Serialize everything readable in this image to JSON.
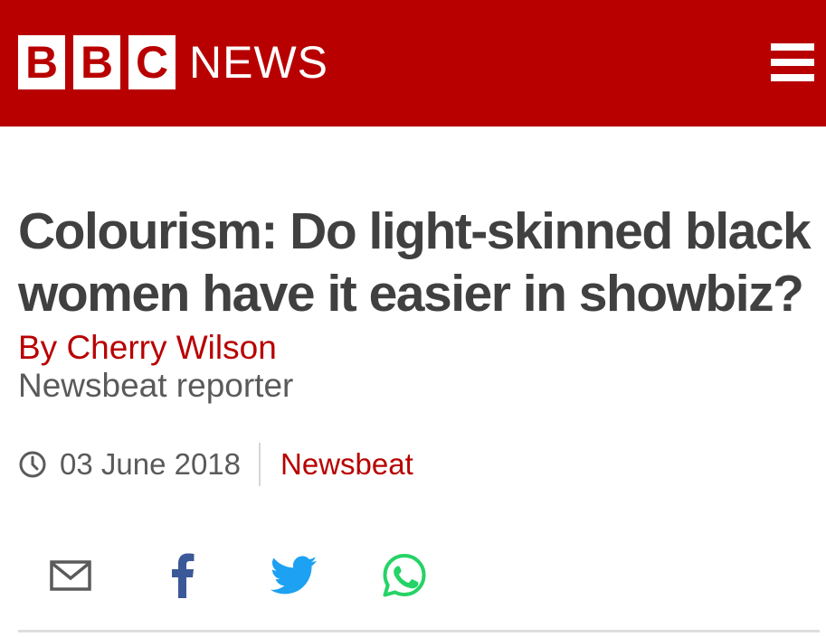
{
  "header": {
    "logo_letters": [
      "B",
      "B",
      "C"
    ],
    "logo_word": "NEWS",
    "menu_icon": "hamburger-menu-icon",
    "background_color": "#b80000"
  },
  "article": {
    "headline": "Colourism: Do light-skinned black women have it easier in showbiz?",
    "byline": "By Cherry Wilson",
    "role": "Newsbeat reporter",
    "date": "03 June 2018",
    "section": "Newsbeat"
  },
  "icons": {
    "date": "clock-icon",
    "share": [
      "email-icon",
      "facebook-icon",
      "twitter-icon",
      "whatsapp-icon"
    ]
  },
  "colors": {
    "accent": "#b80000",
    "headline_text": "#404040",
    "secondary_text": "#5a5a5a",
    "facebook": "#3b5998",
    "twitter": "#1da1f2",
    "whatsapp": "#25d366"
  }
}
